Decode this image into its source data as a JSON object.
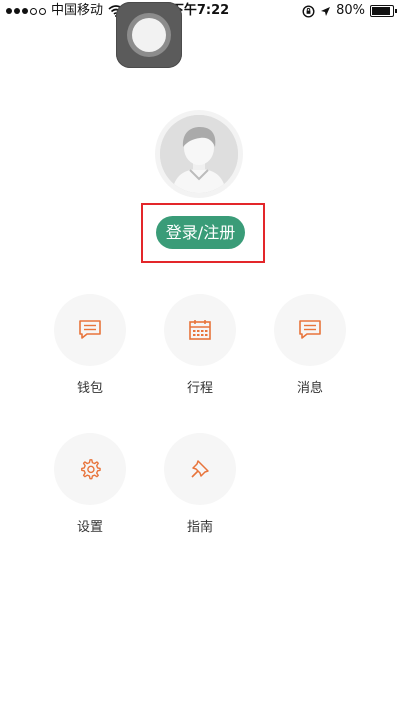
{
  "status_bar": {
    "carrier": "中国移动",
    "time": "下午7:22",
    "battery_percent": "80%",
    "battery_level": 0.8
  },
  "profile": {
    "login_label": "登录/注册"
  },
  "menu": {
    "items": [
      {
        "label": "钱包",
        "icon": "chat-icon"
      },
      {
        "label": "行程",
        "icon": "calendar-icon"
      },
      {
        "label": "消息",
        "icon": "message-icon"
      },
      {
        "label": "设置",
        "icon": "gear-icon"
      },
      {
        "label": "指南",
        "icon": "pin-icon"
      }
    ]
  },
  "colors": {
    "accent": "#3a9c78",
    "icon": "#e8743b",
    "highlight": "#e3262a"
  }
}
